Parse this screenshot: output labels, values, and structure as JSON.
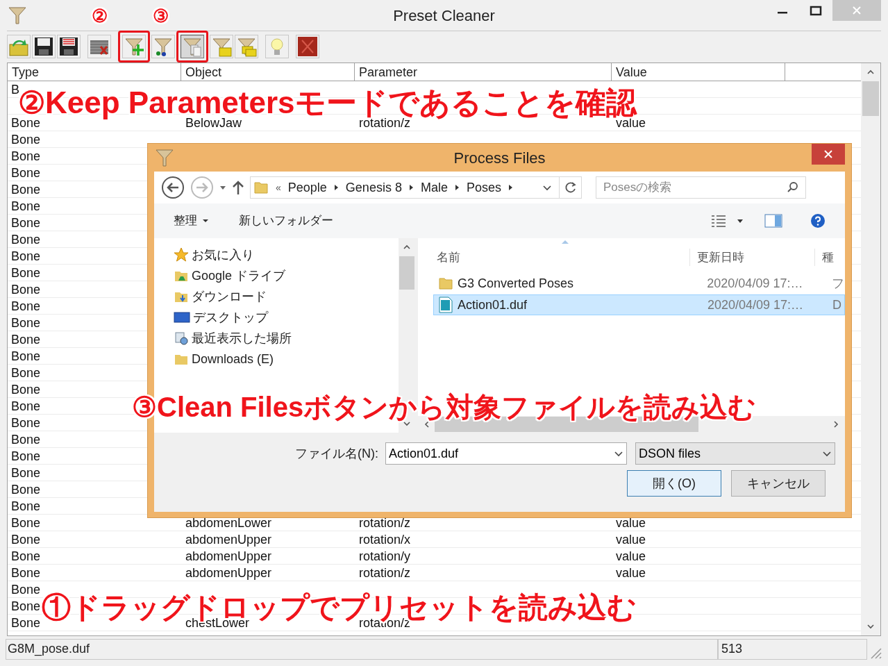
{
  "window": {
    "title": "Preset Cleaner"
  },
  "toolbar_groups": [
    {
      "tools": [
        {
          "kind": "open",
          "pressed": false,
          "highlighted": false
        },
        {
          "kind": "save",
          "pressed": false,
          "highlighted": false
        },
        {
          "kind": "save-list",
          "pressed": false,
          "highlighted": false
        }
      ]
    },
    {
      "tools": [
        {
          "kind": "delete",
          "pressed": false,
          "highlighted": false
        }
      ]
    },
    {
      "tools": [
        {
          "kind": "funnel-plus",
          "pressed": false,
          "highlighted": true
        },
        {
          "kind": "funnel-dots",
          "pressed": false,
          "highlighted": false
        },
        {
          "kind": "funnel-pages",
          "pressed": true,
          "highlighted": true
        },
        {
          "kind": "funnel-folder",
          "pressed": false,
          "highlighted": false
        },
        {
          "kind": "funnel-folders",
          "pressed": false,
          "highlighted": false
        }
      ]
    },
    {
      "tools": [
        {
          "kind": "bulb",
          "pressed": false,
          "highlighted": false
        }
      ]
    },
    {
      "tools": [
        {
          "kind": "stop",
          "pressed": false,
          "highlighted": false
        }
      ]
    }
  ],
  "table": {
    "columns": [
      "Type",
      "Object",
      "Parameter",
      "Value"
    ],
    "rows": [
      {
        "type": "B"
      },
      {},
      {
        "type": "Bone",
        "object": "BelowJaw",
        "parameter": "rotation/z",
        "value": "value"
      },
      {
        "type": "Bone"
      },
      {
        "type": "Bone"
      },
      {
        "type": "Bone"
      },
      {
        "type": "Bone"
      },
      {
        "type": "Bone"
      },
      {
        "type": "Bone"
      },
      {
        "type": "Bone"
      },
      {
        "type": "Bone"
      },
      {
        "type": "Bone"
      },
      {
        "type": "Bone"
      },
      {
        "type": "Bone"
      },
      {
        "type": "Bone"
      },
      {
        "type": "Bone"
      },
      {
        "type": "Bone"
      },
      {
        "type": "Bone"
      },
      {
        "type": "Bone"
      },
      {
        "type": "Bone"
      },
      {
        "type": "Bone"
      },
      {
        "type": "Bone"
      },
      {
        "type": "Bone"
      },
      {
        "type": "Bone"
      },
      {
        "type": "Bone"
      },
      {
        "type": "Bone"
      },
      {
        "type": "Bone",
        "object": "abdomenLower",
        "parameter": "rotation/z",
        "value": "value"
      },
      {
        "type": "Bone",
        "object": "abdomenUpper",
        "parameter": "rotation/x",
        "value": "value"
      },
      {
        "type": "Bone",
        "object": "abdomenUpper",
        "parameter": "rotation/y",
        "value": "value"
      },
      {
        "type": "Bone",
        "object": "abdomenUpper",
        "parameter": "rotation/z",
        "value": "value"
      },
      {
        "type": "Bone"
      },
      {
        "type": "Bone"
      },
      {
        "type": "Bone",
        "object": "chestLower",
        "parameter": "rotation/z"
      }
    ]
  },
  "status_bar": {
    "file": "G8M_pose.duf",
    "count": "513"
  },
  "dialog": {
    "title": "Process Files",
    "path": {
      "overflow": "«",
      "crumbs": [
        "People",
        "Genesis 8",
        "Male",
        "Poses"
      ]
    },
    "search": {
      "placeholder": "Posesの検索"
    },
    "commands": {
      "organize": "整理",
      "new_folder": "新しいフォルダー"
    },
    "nav": [
      {
        "kind": "star",
        "label": "お気に入り"
      },
      {
        "kind": "drive",
        "label": "Google ドライブ"
      },
      {
        "kind": "download",
        "label": "ダウンロード"
      },
      {
        "kind": "desktop",
        "label": "デスクトップ"
      },
      {
        "kind": "recent",
        "label": "最近表示した場所"
      },
      {
        "kind": "folder",
        "label": "Downloads (E)"
      }
    ],
    "columns": [
      "名前",
      "更新日時",
      "種"
    ],
    "files": [
      {
        "kind": "folder",
        "name": "G3 Converted Poses",
        "date": "2020/04/09 17:…",
        "type": "フ",
        "selected": false
      },
      {
        "kind": "duf",
        "name": "Action01.duf",
        "date": "2020/04/09 17:…",
        "type": "D",
        "selected": true
      }
    ],
    "filename_label": "ファイル名(N):",
    "filename": "Action01.duf",
    "filter": "DSON files",
    "open": "開く(O)",
    "cancel": "キャンセル"
  },
  "annotations": {
    "markers": [
      "②",
      "③"
    ],
    "keep": "②Keep Parametersモードであることを確認",
    "clean": "③Clean Filesボタンから対象ファイルを読み込む",
    "drag": "①ドラッグドロップでプリセットを読み込む"
  }
}
